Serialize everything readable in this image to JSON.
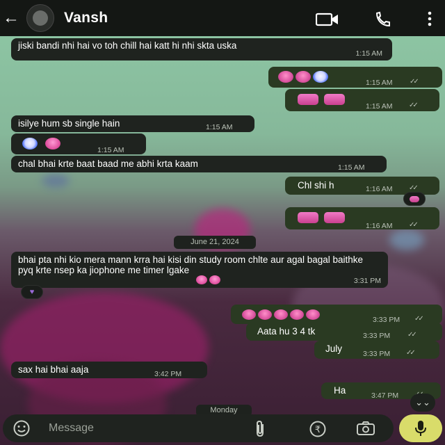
{
  "header": {
    "back_icon": "arrow-left-icon",
    "contact_name": "Vansh",
    "video_icon": "video-camera-icon",
    "call_icon": "phone-icon",
    "menu_icon": "vertical-dots-icon"
  },
  "messages": {
    "m1": {
      "text": "jiski bandi nhi hai vo toh chill hai katt hi nhi skta uska",
      "time": "1:15 AM"
    },
    "m2": {
      "time": "1:15 AM",
      "ticks": "✓✓"
    },
    "m3": {
      "time": "1:15 AM",
      "ticks": "✓✓"
    },
    "m4": {
      "text": "isilye hum sb single hain",
      "time": "1:15 AM"
    },
    "m5": {
      "time": "1:15 AM"
    },
    "m6": {
      "text": "chal bhai krte baat baad me abhi krta kaam",
      "time": "1:15 AM"
    },
    "m7": {
      "text": "Chl shi h",
      "time": "1:16 AM",
      "ticks": "✓✓"
    },
    "m8": {
      "time": "1:16 AM",
      "ticks": "✓✓"
    },
    "date_chip": "June 21, 2024",
    "m9": {
      "text": "bhai pta nhi kio mera mann krra hai kisi din study room chlte aur agal bagal baithke pyq krte nsep ka jiophone me timer lgake",
      "time": "3:31 PM"
    },
    "m10": {
      "time": "3:33 PM",
      "ticks": "✓✓"
    },
    "m11": {
      "text": "Aata hu 3 4 tk",
      "time": "3:33 PM",
      "ticks": "✓✓"
    },
    "m12": {
      "text": "July",
      "time": "3:33 PM",
      "ticks": "✓✓"
    },
    "m13": {
      "text": "sax hai bhai aaja",
      "time": "3:42 PM"
    },
    "m14": {
      "text": "Ha",
      "time": "3:47 PM",
      "ticks": "✓✓"
    },
    "monday_chip": "Monday"
  },
  "composer": {
    "placeholder": "Message",
    "emoji_icon": "smiley-icon",
    "attach_icon": "paperclip-icon",
    "rupee_icon": "rupee-icon",
    "camera_icon": "camera-icon",
    "mic_icon": "microphone-icon",
    "scroll_icon": "double-chevron-down-icon"
  },
  "colors": {
    "header_bg": "#141714",
    "incoming_bubble": "#1f231f",
    "outgoing_bubble": "#2a3a22",
    "mic_button": "#d9dc6a"
  }
}
